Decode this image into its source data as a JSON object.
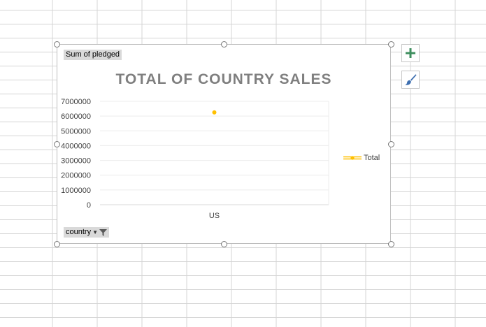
{
  "colors": {
    "grid": "#d4d4d4",
    "series": "#ffc000",
    "title": "#7f7f7f",
    "plus": "#3f8f5f",
    "brush": "#3e6fb0"
  },
  "field_buttons": {
    "value_field": "Sum of pledged",
    "axis_field": "country"
  },
  "icons": {
    "add_element": "plus-icon",
    "style": "paintbrush-icon",
    "filter": "filter-icon",
    "dropdown": "dropdown-arrow-icon"
  },
  "chart_data": {
    "type": "line",
    "title": "TOTAL OF COUNTRY SALES",
    "categories": [
      "US"
    ],
    "series": [
      {
        "name": "Total",
        "values": [
          6250000
        ]
      }
    ],
    "y_ticks": [
      0,
      1000000,
      2000000,
      3000000,
      4000000,
      5000000,
      6000000,
      7000000
    ],
    "ylim": [
      0,
      7000000
    ],
    "grid": true,
    "legend": "right"
  }
}
